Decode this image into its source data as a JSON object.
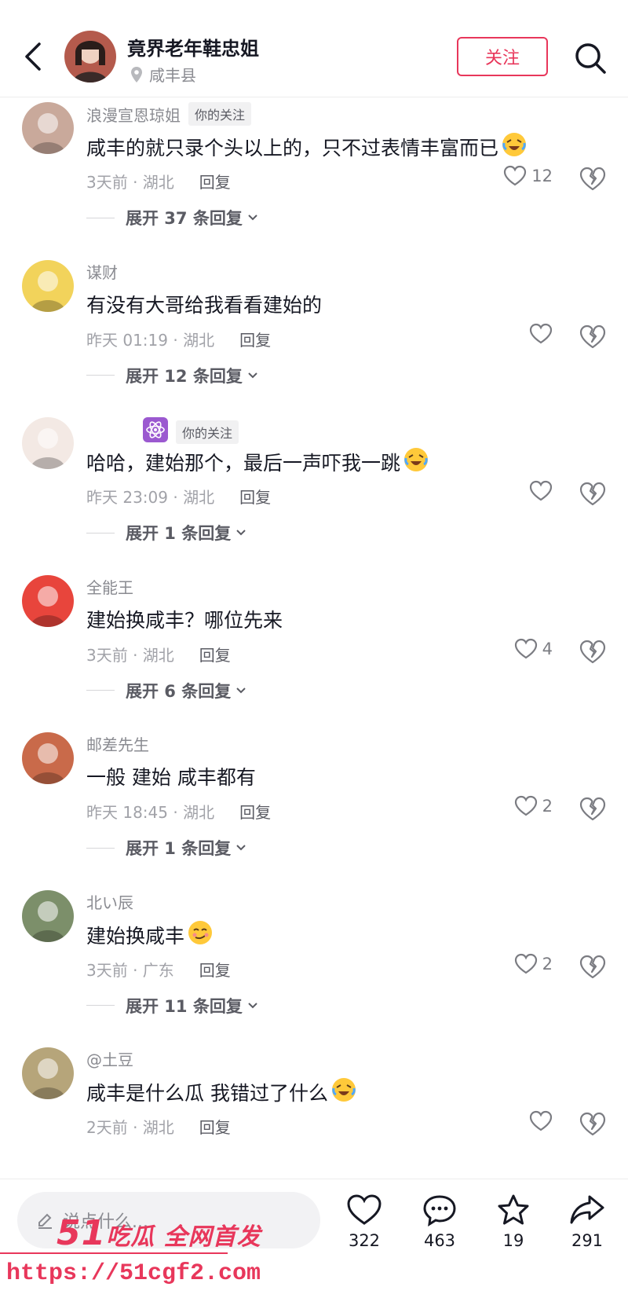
{
  "header": {
    "title": "竟界老年鞋忠姐",
    "location": "咸丰县",
    "follow_label": "关注"
  },
  "comments": [
    {
      "user": "浪漫宣恩琼姐",
      "tag": "你的关注",
      "text": "咸丰的就只录个头以上的，只不过表情丰富而已",
      "emoji": "laughing-crying-emoji",
      "time": "3天前 · 湖北",
      "reply": "回复",
      "likes": "12",
      "expand": "展开 37 条回复",
      "avatar_color": "#c9a99b"
    },
    {
      "user": "谋财",
      "tag": "",
      "text": "有没有大哥给我看看建始的",
      "emoji": "",
      "time": "昨天 01:19 · 湖北",
      "reply": "回复",
      "likes": "",
      "expand": "展开 12 条回复",
      "avatar_color": "#f2d35b"
    },
    {
      "user": "",
      "tag": "你的关注",
      "text": "哈哈，建始那个，最后一声吓我一跳",
      "emoji": "laughing-crying-emoji",
      "time": "昨天 23:09 · 湖北",
      "reply": "回复",
      "likes": "",
      "expand": "展开 1 条回复",
      "avatar_color": "#f3e9e4"
    },
    {
      "user": "全能王",
      "tag": "",
      "text": "建始换咸丰？哪位先来",
      "emoji": "",
      "time": "3天前 · 湖北",
      "reply": "回复",
      "likes": "4",
      "expand": "展开 6 条回复",
      "avatar_color": "#e8453c"
    },
    {
      "user": "邮差先生",
      "tag": "",
      "text": "一般 建始 咸丰都有",
      "emoji": "",
      "time": "昨天 18:45 · 湖北",
      "reply": "回复",
      "likes": "2",
      "expand": "展开 1 条回复",
      "avatar_color": "#c96a4a"
    },
    {
      "user": "北い辰",
      "tag": "",
      "text": "建始换咸丰",
      "emoji": "smirk-emoji",
      "time": "3天前 · 广东",
      "reply": "回复",
      "likes": "2",
      "expand": "展开 11 条回复",
      "avatar_color": "#7c8f6a"
    },
    {
      "user": "@土豆",
      "tag": "",
      "text": "咸丰是什么瓜 我错过了什么",
      "emoji": "laughing-crying-emoji",
      "time": "2天前 · 湖北",
      "reply": "回复",
      "likes": "",
      "expand": "",
      "avatar_color": "#b6a57a"
    }
  ],
  "bottom": {
    "input_placeholder": "说点什么...",
    "like_count": "322",
    "comment_count": "463",
    "favorite_count": "19",
    "share_count": "291"
  },
  "watermark": {
    "brand_num": "51",
    "brand_text": "吃瓜 全网首发",
    "url": "https://51cgf2.com"
  },
  "colors": {
    "accent": "#e8375b",
    "muted": "#8a8b91"
  }
}
